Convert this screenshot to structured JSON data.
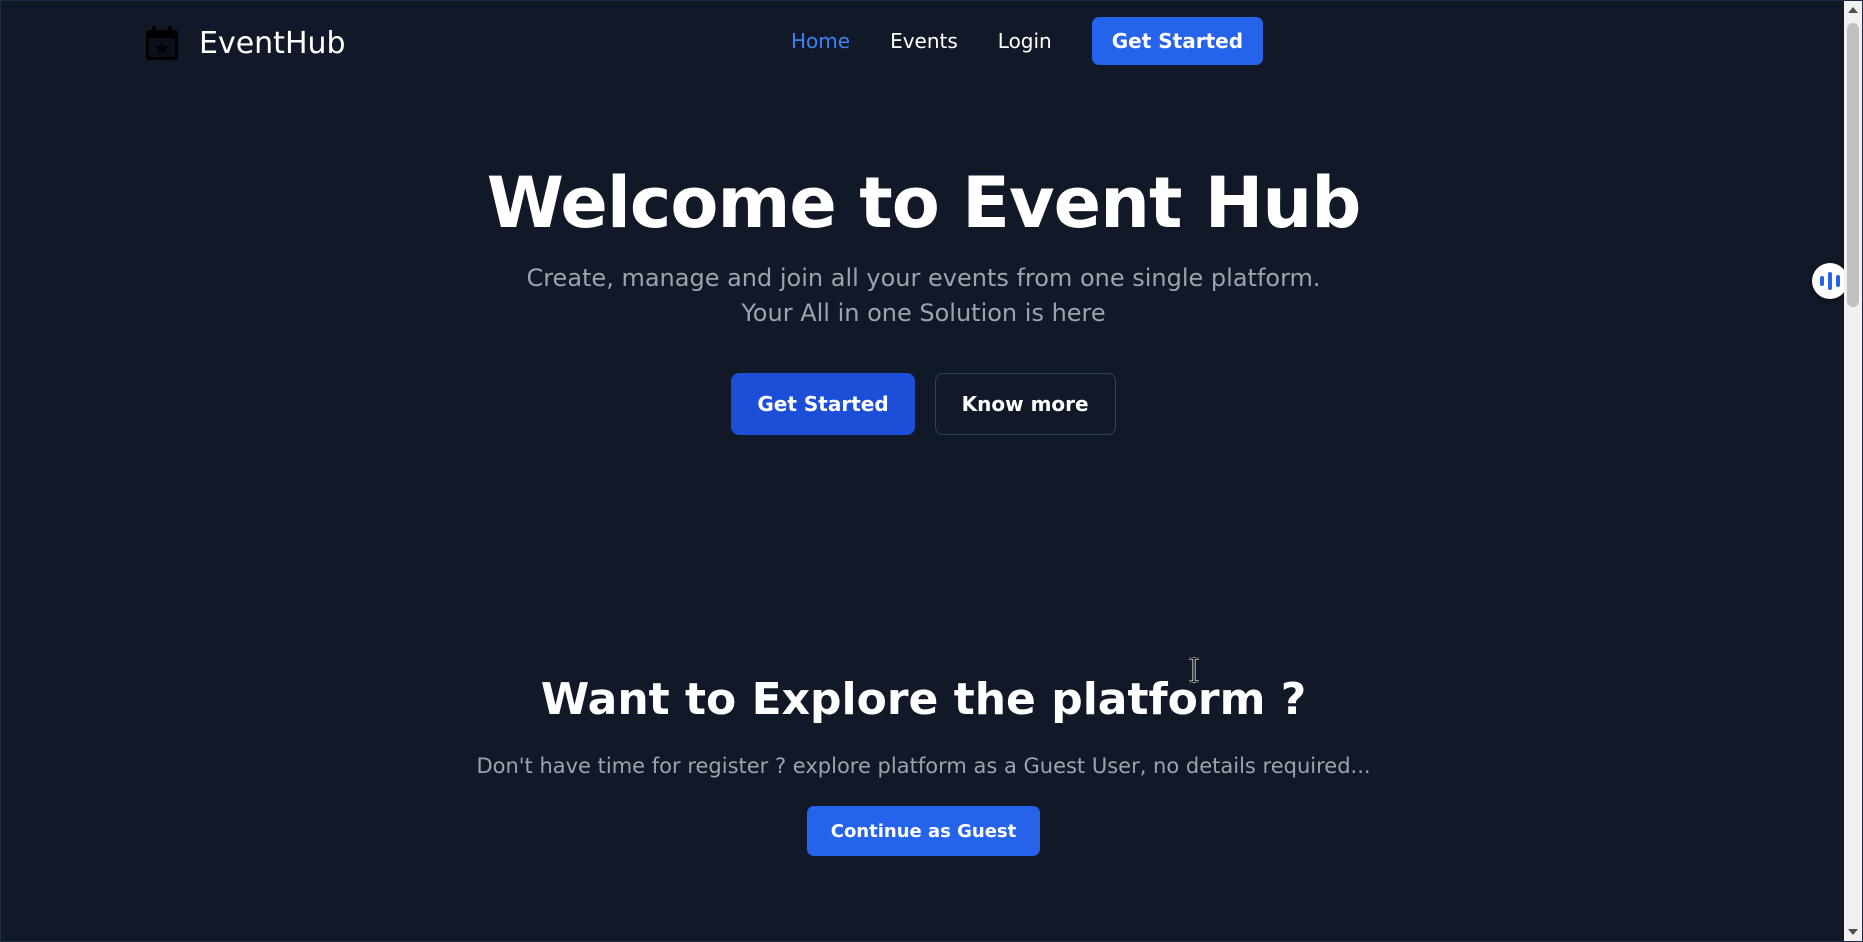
{
  "brand": {
    "name": "EventHub",
    "icon": "calendar-star-icon"
  },
  "nav": {
    "links": [
      {
        "label": "Home",
        "active": true
      },
      {
        "label": "Events",
        "active": false
      },
      {
        "label": "Login",
        "active": false
      }
    ],
    "cta_label": "Get Started"
  },
  "hero": {
    "title": "Welcome to Event Hub",
    "subtitle_line1": "Create, manage and join all your events from one single platform.",
    "subtitle_line2": "Your All in one Solution is here",
    "primary_label": "Get Started",
    "secondary_label": "Know more"
  },
  "explore": {
    "title": "Want to Explore the platform ?",
    "subtitle": "Don't have time for register ? explore platform as a Guest User, no details required...",
    "button_label": "Continue as Guest"
  },
  "widgets": {
    "floating_icon": "audio-bars-icon"
  },
  "colors": {
    "background": "#111827",
    "accent": "#2563eb",
    "active_link": "#3b82f6",
    "muted_text": "#9ca3af"
  }
}
